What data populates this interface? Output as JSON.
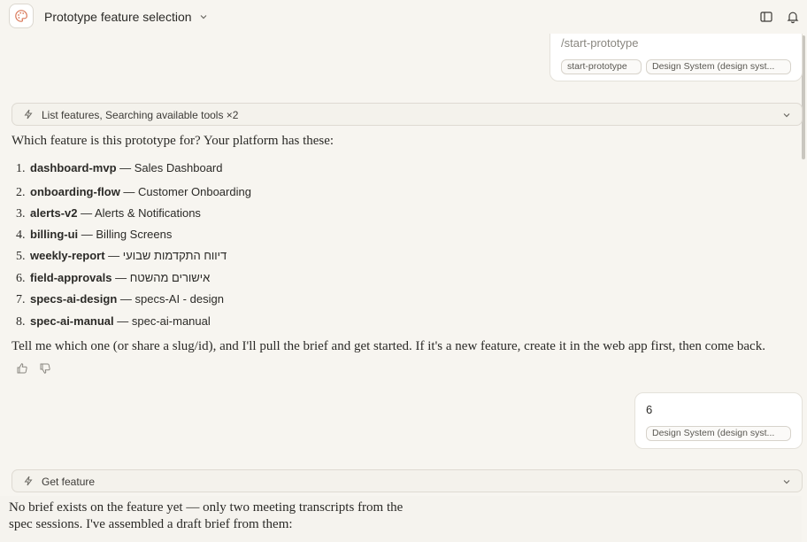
{
  "header": {
    "title": "Prototype feature selection"
  },
  "top_user_message": {
    "command": "/start-prototype",
    "chips": [
      "start-prototype",
      "Design System (design syst..."
    ]
  },
  "tool_call_1": {
    "label": "List features, Searching available tools ×2"
  },
  "assistant_1": {
    "intro": "Which feature is this prototype for? Your platform has these:",
    "features": [
      {
        "num": "1.",
        "slug": "dashboard-mvp",
        "name": "Sales Dashboard"
      },
      {
        "num": "2.",
        "slug": "onboarding-flow",
        "name": "Customer Onboarding"
      },
      {
        "num": "3.",
        "slug": "alerts-v2",
        "name": "Alerts & Notifications"
      },
      {
        "num": "4.",
        "slug": "billing-ui",
        "name": "Billing Screens"
      },
      {
        "num": "5.",
        "slug": "weekly-report",
        "name": "דיווח התקדמות שבועי"
      },
      {
        "num": "6.",
        "slug": "field-approvals",
        "name": "אישורים מהשטח"
      },
      {
        "num": "7.",
        "slug": "specs-ai-design",
        "name": "specs-AI - design"
      },
      {
        "num": "8.",
        "slug": "spec-ai-manual",
        "name": "spec-ai-manual"
      }
    ],
    "separator": " — ",
    "outro": "Tell me which one (or share a slug/id), and I'll pull the brief and get started. If it's a new feature, create it in the web app first, then come back."
  },
  "user_reply": {
    "text": "6",
    "chip": "Design System (design syst..."
  },
  "tool_call_2": {
    "label": "Get feature"
  },
  "assistant_2": {
    "line1": "No brief exists on the feature yet — only two meeting transcripts from the",
    "line2": "spec sessions. I've assembled a draft brief from them:"
  },
  "icons": {
    "app": "palette-icon",
    "title_chevron": "chevron-down-icon",
    "sidebar_toggle": "sidebar-icon",
    "notifications": "bell-icon",
    "tool": "bolt-icon",
    "expand": "chevron-down-icon",
    "thumbs_up": "thumbs-up-icon",
    "thumbs_down": "thumbs-down-icon"
  },
  "colors": {
    "background": "#f7f5f0",
    "accent": "#d97757",
    "card": "#ffffff"
  }
}
